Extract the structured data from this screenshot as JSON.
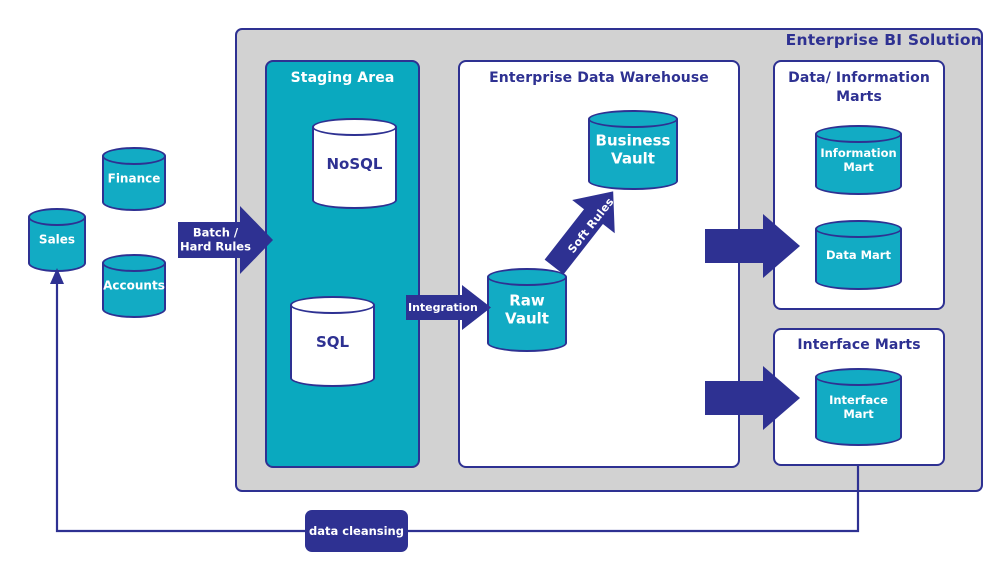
{
  "enterprise": {
    "title": "Enterprise BI Solution",
    "bg_color": "#d2d2d2",
    "border_color": "#2e3192"
  },
  "colors": {
    "navy": "#2e3192",
    "teal": "#12abc4",
    "staging_teal": "#0aa9bf",
    "gray": "#d2d2d2",
    "white": "#ffffff"
  },
  "sources": [
    {
      "id": "sales",
      "label": "Sales"
    },
    {
      "id": "finance",
      "label": "Finance"
    },
    {
      "id": "accounts",
      "label": "Accounts"
    }
  ],
  "staging": {
    "title": "Staging Area",
    "cylinders": [
      {
        "id": "nosql",
        "label": "NoSQL"
      },
      {
        "id": "sql",
        "label": "SQL"
      }
    ]
  },
  "edw": {
    "title": "Enterprise Data Warehouse",
    "cylinders": [
      {
        "id": "business-vault",
        "label": "Business\nVault",
        "line1": "Business",
        "line2": "Vault"
      },
      {
        "id": "raw-vault",
        "label": "Raw\nVault",
        "line1": "Raw",
        "line2": "Vault"
      }
    ]
  },
  "marts": {
    "title": "Data/ Information Marts",
    "title_line1": "Data/ Information",
    "title_line2": "Marts",
    "cylinders": [
      {
        "id": "information-mart",
        "line1": "Information",
        "line2": "Mart"
      },
      {
        "id": "data-mart",
        "line1": "Data Mart",
        "line2": ""
      }
    ]
  },
  "interface_marts": {
    "title": "Interface Marts",
    "cylinders": [
      {
        "id": "interface-mart",
        "line1": "Interface",
        "line2": "Mart"
      }
    ]
  },
  "arrows": {
    "batch": {
      "line1": "Batch /",
      "line2": "Hard Rules"
    },
    "integration": {
      "label": "Integration"
    },
    "soft_rules": {
      "label": "Soft Rules"
    },
    "to_marts": {
      "label": ""
    },
    "to_interface": {
      "label": ""
    }
  },
  "feedback": {
    "label": "data cleansing"
  }
}
